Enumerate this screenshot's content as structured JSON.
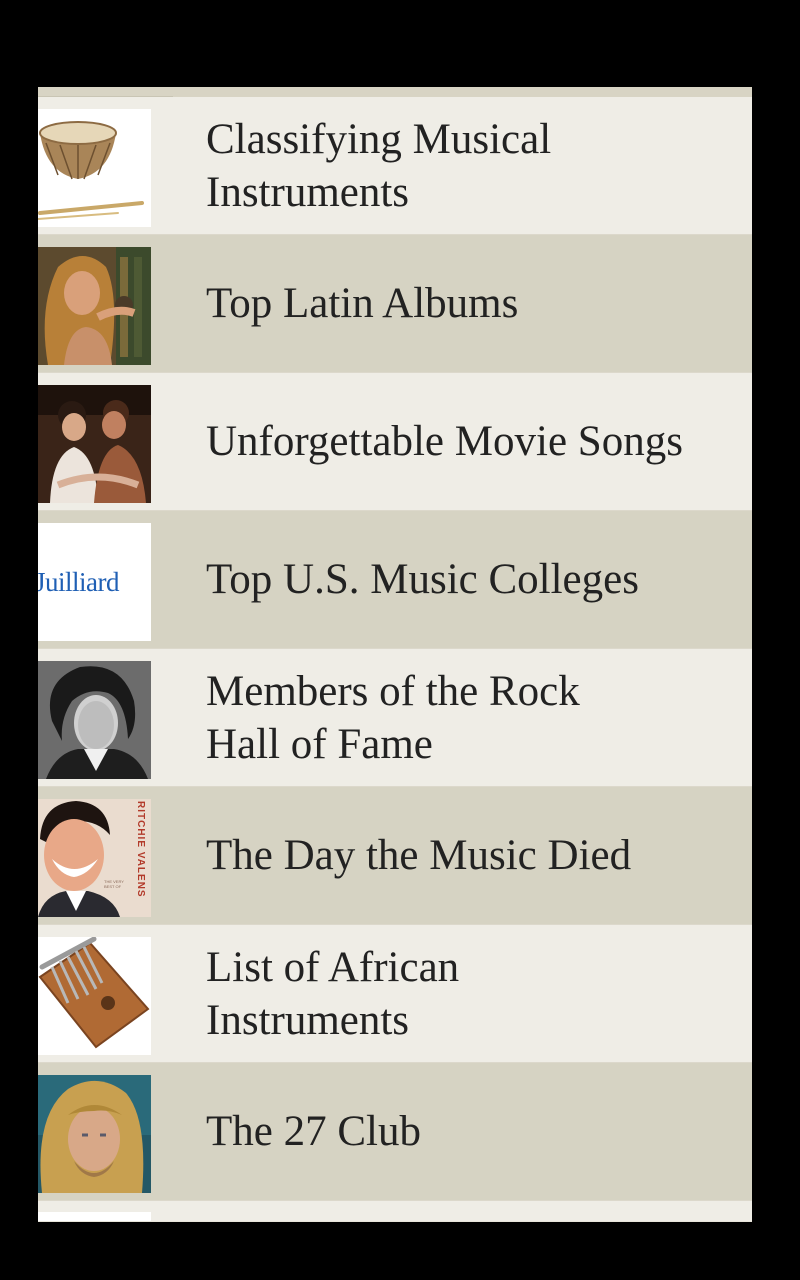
{
  "list": {
    "items": [
      {
        "title": "Classifying Musical\nInstruments",
        "icon": "drum-thumbnail"
      },
      {
        "title": "Top Latin Albums",
        "icon": "singer-thumbnail"
      },
      {
        "title": "Unforgettable Movie Songs",
        "icon": "movie-couple-thumbnail"
      },
      {
        "title": "Top U.S. Music Colleges",
        "icon": "juilliard-logo-thumbnail",
        "thumb_text": "Juilliard"
      },
      {
        "title": "Members of the Rock\nHall of Fame",
        "icon": "rock-star-portrait-thumbnail"
      },
      {
        "title": "The Day the Music Died",
        "icon": "album-cover-thumbnail",
        "thumb_text": "RITCHIE VALENS",
        "thumb_subtext": "THE VERY BEST OF"
      },
      {
        "title": "List of African\nInstruments",
        "icon": "kalimba-thumbnail"
      },
      {
        "title": "The 27 Club",
        "icon": "musician-portrait-thumbnail"
      }
    ]
  },
  "colors": {
    "row_light": "#efede6",
    "row_dark": "#d6d3c3",
    "text": "#222222",
    "frame": "#000000",
    "juilliard_blue": "#1f5fb4"
  }
}
